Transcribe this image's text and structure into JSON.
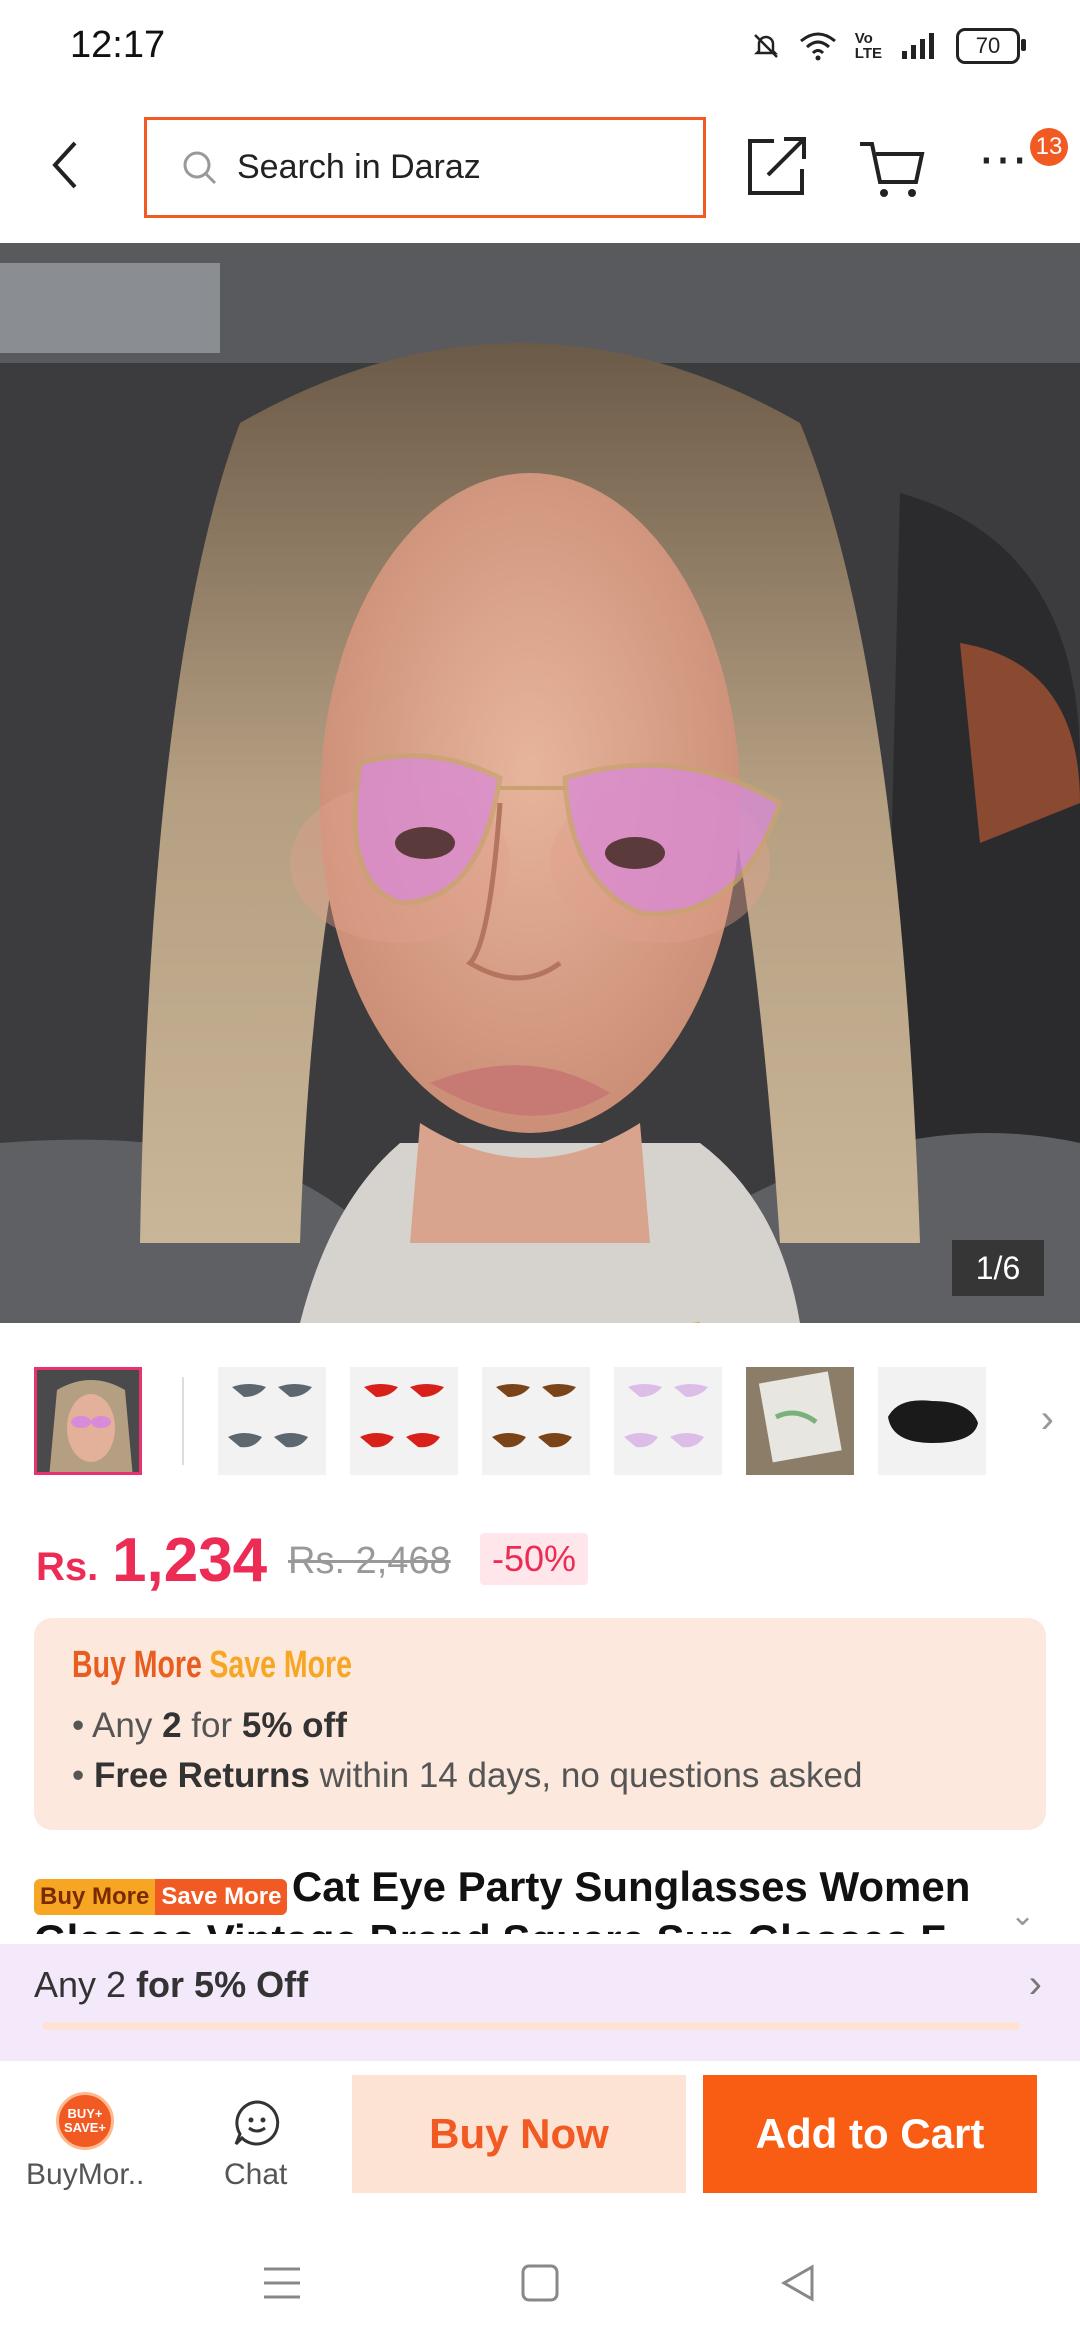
{
  "status_bar": {
    "time": "12:17",
    "battery": "70"
  },
  "top_bar": {
    "search_placeholder": "Search in Daraz",
    "cart_badge": "13"
  },
  "gallery": {
    "counter": "1/6"
  },
  "price": {
    "currency": "Rs.",
    "current": "1,234",
    "original": "Rs. 2,468",
    "discount": "-50%"
  },
  "promo": {
    "title_part1": "Buy More",
    "title_part2": "Save More",
    "line1_pre": "Any ",
    "line1_qty": "2",
    "line1_mid": " for ",
    "line1_off": "5% off",
    "line2_bold": "Free Returns",
    "line2_rest": " within 14 days, no questions asked"
  },
  "product": {
    "tag1": "Buy More",
    "tag2": "Save More",
    "title": "Cat Eye Party Sunglasses Women Glasses Vintage Brand Square Sun Glasses F"
  },
  "offer_bar": {
    "pre": "Any 2 ",
    "bold": "for 5% Off"
  },
  "bottom_bar": {
    "buymore_icon_text": "BUY+ SAVE+",
    "buymore_label": "BuyMor..",
    "chat_label": "Chat",
    "buy_now": "Buy Now",
    "add_to_cart": "Add to Cart"
  },
  "colors": {
    "accent": "#f15a22",
    "price": "#ec2c55",
    "promo_bg": "#fde8dd"
  }
}
